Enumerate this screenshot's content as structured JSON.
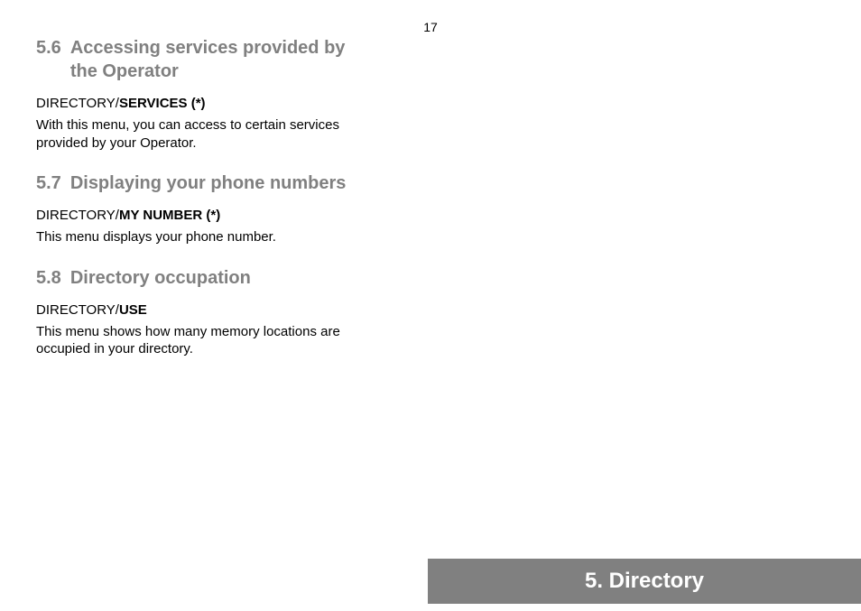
{
  "page_number": "17",
  "sections": [
    {
      "number": "5.6",
      "title": "Accessing services provided by the Operator",
      "path_prefix": "DIRECTORY/",
      "path_bold": "SERVICES (*)",
      "body": "With this menu, you can access to certain services provided by your Operator."
    },
    {
      "number": "5.7",
      "title": "Displaying your phone numbers",
      "path_prefix": "DIRECTORY/",
      "path_bold": "MY NUMBER (*)",
      "body": "This menu displays your phone number."
    },
    {
      "number": "5.8",
      "title": "Directory occupation",
      "path_prefix": "DIRECTORY/",
      "path_bold": "USE",
      "body": "This menu shows how many memory locations are occupied in your directory."
    }
  ],
  "footer": {
    "label": "5. Directory"
  }
}
